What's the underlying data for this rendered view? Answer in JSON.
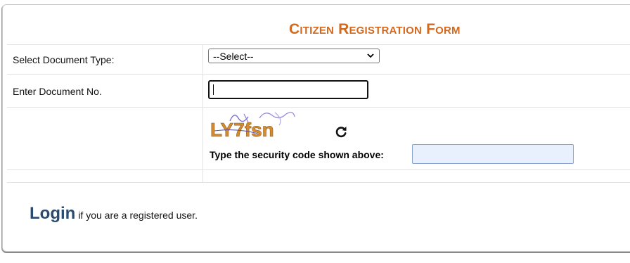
{
  "form": {
    "title": "Citizen Registration Form",
    "document_type_label": "Select Document Type:",
    "document_type_selected": "--Select--",
    "document_no_label": "Enter Document No.",
    "document_no_value": "",
    "captcha_text": "LY7fsn",
    "security_code_label": "Type the security code shown above:",
    "security_code_value": ""
  },
  "footer": {
    "login_link": "Login",
    "login_suffix": "if you are a registered user."
  },
  "colors": {
    "title": "#d2691e",
    "login_link": "#2b4a6f",
    "security_input_bg": "#e8f0fe"
  },
  "icons": {
    "select_arrow": "chevron-down-icon",
    "refresh": "refresh-icon"
  }
}
